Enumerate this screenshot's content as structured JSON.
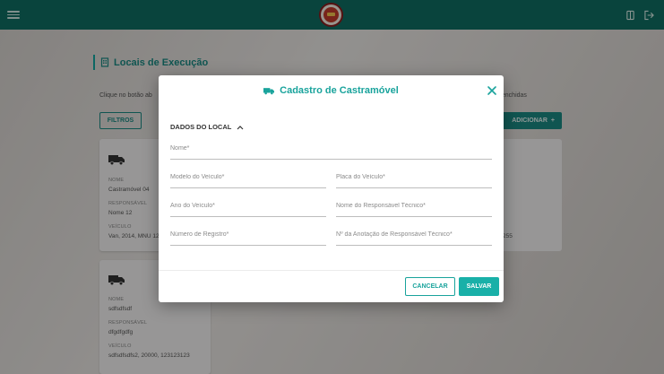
{
  "header": {
    "menu_icon": "menu-icon",
    "logo_icon": "castramovel-logo",
    "right_icons": [
      "book-icon",
      "logout-icon"
    ],
    "colors": {
      "bar": "#0f6e63"
    }
  },
  "page": {
    "title": "Locais de Execução",
    "title_icon": "building-icon",
    "hint_left": "Clique no botão ab",
    "hint_right": "eenchidas",
    "filters_label": "FILTROS",
    "add_label": "ADICIONAR",
    "add_icon": "plus-icon",
    "cards": [
      {
        "icon": "truck-icon",
        "name_label": "NOME",
        "name": "Castramóvel 04",
        "resp_label": "RESPONSÁVEL",
        "resp": "Nome 12",
        "vehicle_label": "VEÍCULO",
        "vehicle": "Van, 2014, MNU 12"
      },
      {
        "icon": "truck-icon",
        "name_label": "NOME",
        "name": "sdfsdfsdf",
        "resp_label": "RESPONSÁVEL",
        "resp": "dfgdfgdfg",
        "vehicle_label": "VEÍCULO",
        "vehicle": "sdfsdfsdfs2, 20000, 123123123"
      }
    ],
    "right_card_value": "255"
  },
  "modal": {
    "title": "Cadastro de Castramóvel",
    "title_icon": "truck-icon",
    "close_icon": "close-icon",
    "section_label": "DADOS DO LOCAL",
    "section_icon": "chevron-up-icon",
    "fields": {
      "nome": {
        "placeholder": "Nome*",
        "value": ""
      },
      "modelo": {
        "placeholder": "Modelo do Veículo*",
        "value": ""
      },
      "placa": {
        "placeholder": "Placa do Veículo*",
        "value": ""
      },
      "ano": {
        "placeholder": "Ano do Veículo*",
        "value": ""
      },
      "responsavel": {
        "placeholder": "Nome do Responsável Técnico*",
        "value": ""
      },
      "registro": {
        "placeholder": "Número de Registro*",
        "value": ""
      },
      "art": {
        "placeholder": "Nº da Anotação de Responsável Técnico*",
        "value": ""
      }
    },
    "cancel_label": "CANCELAR",
    "save_label": "SALVAR",
    "colors": {
      "accent": "#19a39c"
    }
  }
}
